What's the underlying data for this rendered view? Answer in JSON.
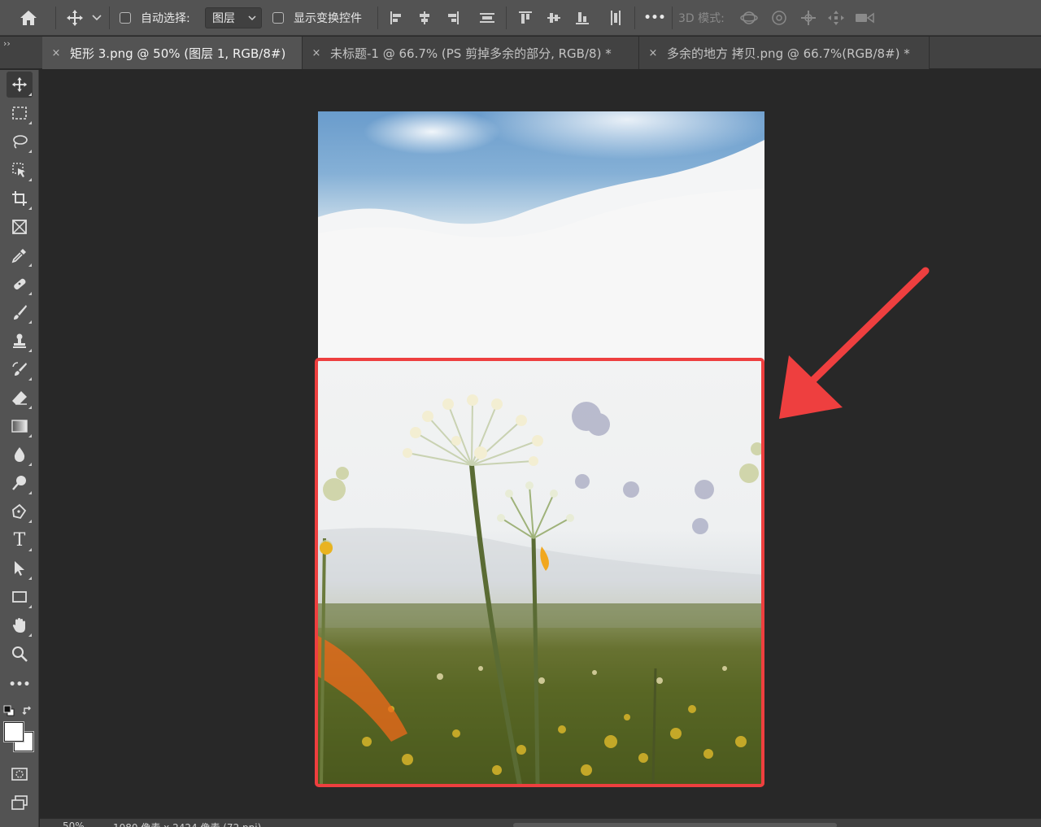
{
  "options_bar": {
    "auto_select_label": "自动选择:",
    "auto_select_target": "图层",
    "show_transform_label": "显示变换控件",
    "mode_3d_label": "3D 模式:",
    "more_label": "•••"
  },
  "tabs": {
    "collapse_label": "››",
    "items": [
      {
        "title": "矩形 3.png @ 50% (图层 1, RGB/8#)",
        "close": "×",
        "active": true
      },
      {
        "title": "未标题-1 @ 66.7% (PS 剪掉多余的部分, RGB/8) *",
        "close": "×",
        "active": false
      },
      {
        "title": "多余的地方 拷贝.png @ 66.7%(RGB/8#) *",
        "close": "×",
        "active": false
      }
    ]
  },
  "toolbar": {
    "type_tool_glyph": "T",
    "more_glyph": "•••"
  },
  "canvas": {
    "selection_color": "#ee3f3f",
    "arrow_color": "#ee3f3f"
  },
  "status_bar": {
    "zoom": "50%",
    "info": "1080 像素 x 2424 像素 (72 ppi)"
  },
  "colors": {
    "foreground": "#ffffff",
    "background": "#ffffff"
  }
}
